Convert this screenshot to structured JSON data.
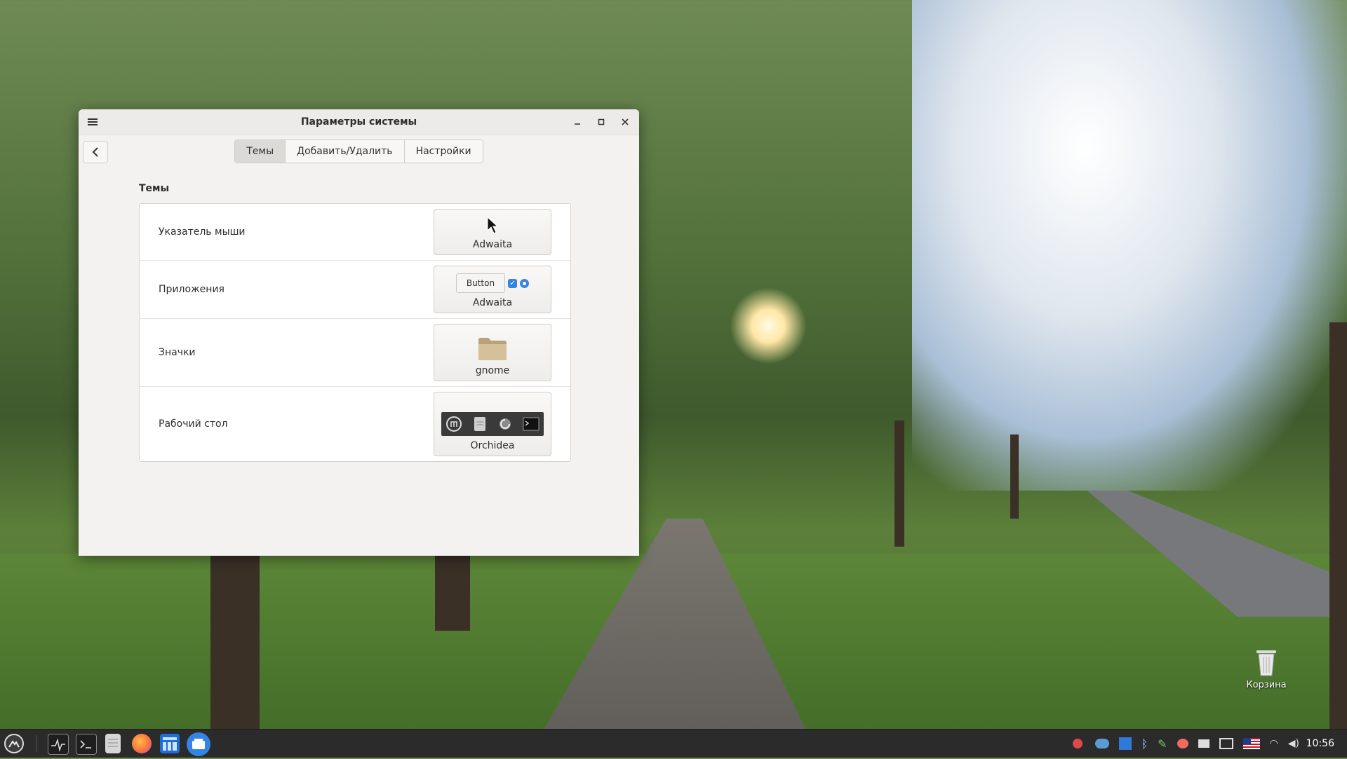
{
  "window": {
    "title": "Параметры системы",
    "tabs": [
      {
        "label": "Темы",
        "active": true
      },
      {
        "label": "Добавить/Удалить",
        "active": false
      },
      {
        "label": "Настройки",
        "active": false
      }
    ],
    "section_title": "Темы",
    "rows": [
      {
        "label": "Указатель мыши",
        "value": "Adwaita",
        "preview": "cursor"
      },
      {
        "label": "Приложения",
        "value": "Adwaita",
        "preview": "app",
        "preview_button": "Button"
      },
      {
        "label": "Значки",
        "value": "gnome",
        "preview": "folder"
      },
      {
        "label": "Рабочий стол",
        "value": "Orchidea",
        "preview": "desktop"
      }
    ]
  },
  "desktop": {
    "trash_label": "Корзина"
  },
  "taskbar": {
    "clock": "10:56",
    "launchers": [
      "menu-icon",
      "system-monitor-icon",
      "terminal-icon",
      "files-icon",
      "firefox-icon",
      "calculator-icon",
      "software-manager-icon"
    ],
    "tray": [
      "update-icon",
      "cloud-icon",
      "network-icon",
      "bluetooth-icon",
      "feather-icon",
      "chat-icon",
      "printer-icon",
      "display-icon",
      "us-flag-icon",
      "wifi-icon",
      "volume-icon"
    ]
  },
  "colors": {
    "accent": "#3584e4",
    "taskbar": "#2b2b2b",
    "window_bg": "#f3f2f1"
  }
}
